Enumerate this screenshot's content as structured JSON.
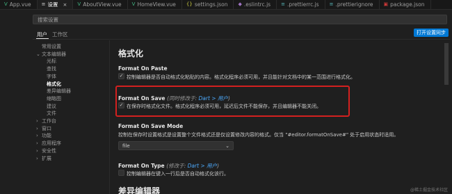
{
  "tabs": [
    {
      "label": "App.vue",
      "icon": "vue-icon",
      "color": "#41b883",
      "active": false
    },
    {
      "label": "设置",
      "icon": "settings-icon",
      "color": "#cccccc",
      "active": true
    },
    {
      "label": "AboutView.vue",
      "icon": "vue-icon",
      "color": "#41b883",
      "active": false
    },
    {
      "label": "HomeView.vue",
      "icon": "vue-icon",
      "color": "#41b883",
      "active": false
    },
    {
      "label": "settings.json",
      "icon": "json-icon",
      "color": "#cbcb41",
      "active": false
    },
    {
      "label": ".eslintrc.js",
      "icon": "eslint-icon",
      "color": "#a074c4",
      "active": false
    },
    {
      "label": ".prettierrc.js",
      "icon": "prettier-icon",
      "color": "#56b3b4",
      "active": false
    },
    {
      "label": ".prettierignore",
      "icon": "prettier-icon",
      "color": "#56b3b4",
      "active": false
    },
    {
      "label": "package.json",
      "icon": "npm-icon",
      "color": "#cb3837",
      "active": false
    }
  ],
  "search": {
    "placeholder": "搜索设置"
  },
  "scope": {
    "user": "用户",
    "workspace": "工作区",
    "sync_button": "打开设置同步"
  },
  "toc": [
    {
      "label": "常用设置",
      "level": 1,
      "chevron": ""
    },
    {
      "label": "文本编辑器",
      "level": 0,
      "chevron": "⌄"
    },
    {
      "label": "光标",
      "level": 2,
      "chevron": ""
    },
    {
      "label": "查找",
      "level": 2,
      "chevron": ""
    },
    {
      "label": "字体",
      "level": 2,
      "chevron": ""
    },
    {
      "label": "格式化",
      "level": 2,
      "chevron": "",
      "selected": true
    },
    {
      "label": "差异编辑器",
      "level": 2,
      "chevron": ""
    },
    {
      "label": "缩略图",
      "level": 2,
      "chevron": ""
    },
    {
      "label": "建议",
      "level": 2,
      "chevron": ""
    },
    {
      "label": "文件",
      "level": 2,
      "chevron": ""
    },
    {
      "label": "工作台",
      "level": 0,
      "chevron": "›"
    },
    {
      "label": "窗口",
      "level": 0,
      "chevron": "›"
    },
    {
      "label": "功能",
      "level": 0,
      "chevron": "›"
    },
    {
      "label": "应用程序",
      "level": 0,
      "chevron": "›"
    },
    {
      "label": "安全性",
      "level": 0,
      "chevron": "›"
    },
    {
      "label": "扩展",
      "level": 0,
      "chevron": "›"
    }
  ],
  "content": {
    "section_title": "格式化",
    "format_on_paste": {
      "title": "Format On Paste",
      "description": "控制编辑器是否自动格式化粘贴的内容。格式化程序必须可用，并且能针对文档中的某一范围进行格式化。",
      "checked": true
    },
    "format_on_save": {
      "title": "Format On Save",
      "modified_prefix": "(同时修改于: ",
      "modified_link": "Dart > 用户",
      "modified_suffix": ")",
      "description": "在保存时格式化文件。格式化程序必须可用，延迟后文件不能保存，并且编辑器不能关闭。",
      "checked": true
    },
    "format_on_save_mode": {
      "title": "Format On Save Mode",
      "description": "控制在保存时设置格式是设置整个文件格式还是仅设置修改内容的格式。仅当 \"#editor.formatOnSave#\" 处于启用状态时适用。",
      "value": "file"
    },
    "format_on_type": {
      "title": "Format On Type",
      "modified_prefix": "(修改于: ",
      "modified_link": "Dart > 用户",
      "modified_suffix": ")",
      "description": "控制编辑器在键入一行后是否自动格式化该行。",
      "checked": false
    },
    "next_section_title": "差异编辑器"
  },
  "watermark": "@稀土掘金技术社区",
  "colors": {
    "accent": "#0078d4",
    "highlight_border": "#d4201f",
    "link": "#4daafc"
  }
}
